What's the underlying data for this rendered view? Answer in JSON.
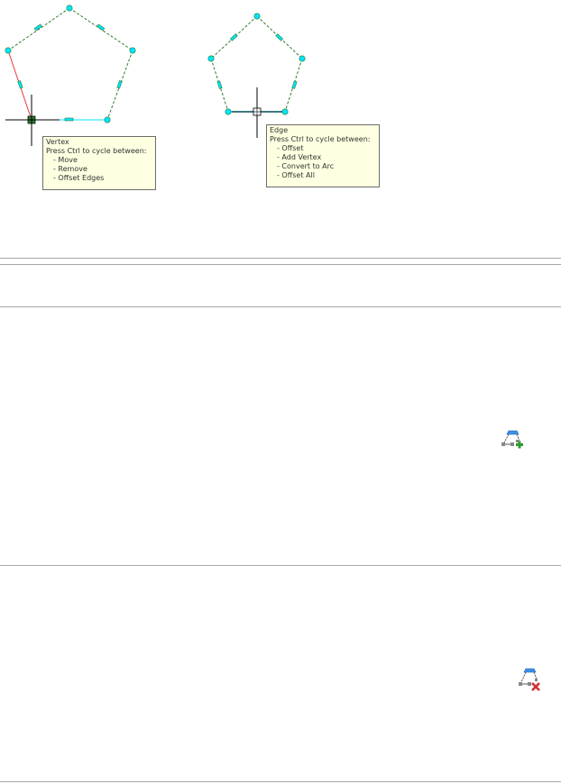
{
  "figure": {
    "line_color": "#2e7d32",
    "grip_color": "#00e5ff",
    "highlight_vertex_edges_color": "#e53935",
    "highlight_edge_color": "#00e5ff",
    "selected_grip_color": "#2e7d32"
  },
  "vertex_tooltip": {
    "title": "Vertex",
    "prompt": "Press Ctrl to cycle between:",
    "options": [
      "- Move",
      "- Remove",
      "- Offset Edges"
    ],
    "background": "#ffffe1"
  },
  "edge_tooltip": {
    "title": "Edge",
    "prompt": "Press Ctrl to cycle between:",
    "options": [
      "- Offset",
      "- Add Vertex",
      "- Convert to Arc",
      "- Offset All"
    ],
    "background": "#ffffe1"
  },
  "icons": {
    "add_vertex": "add-vertex-icon",
    "remove_vertex": "remove-vertex-icon"
  }
}
